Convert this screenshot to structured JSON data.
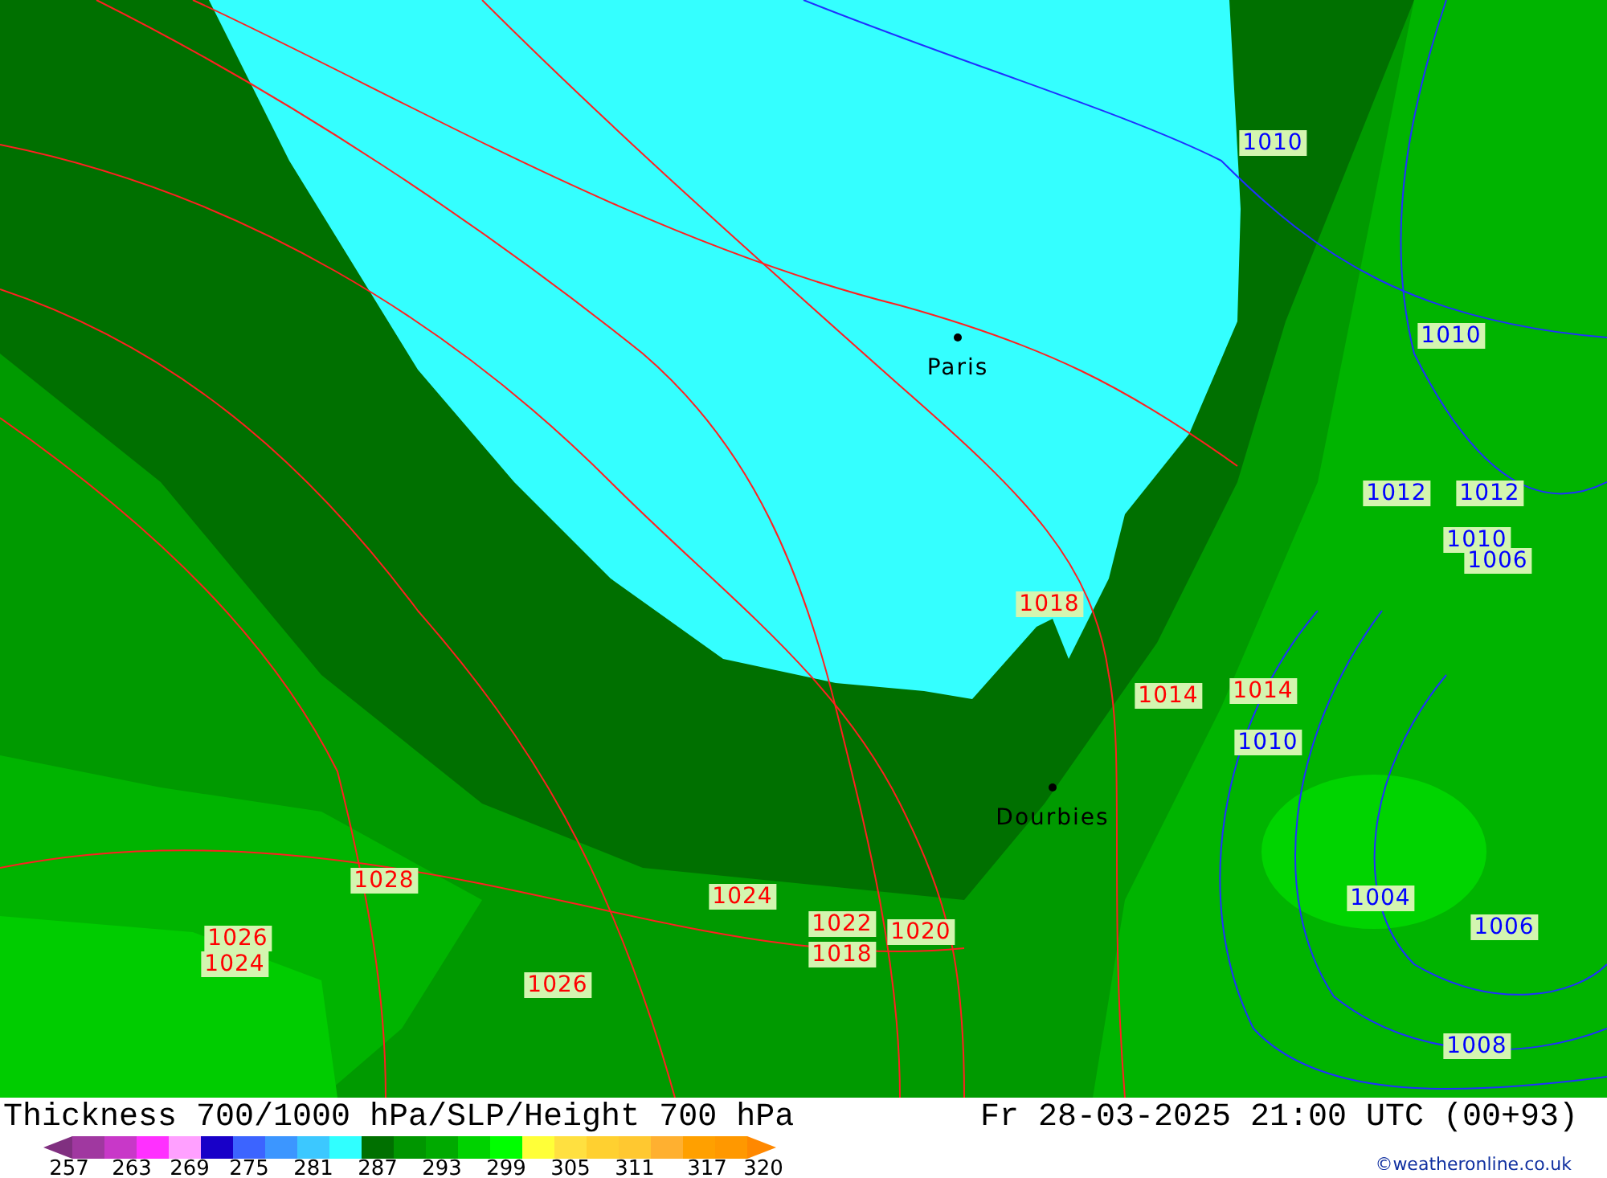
{
  "map": {
    "cities": [
      {
        "name": "Paris"
      },
      {
        "name": "Dourbies"
      }
    ],
    "contour_labels": [
      {
        "text": "1010",
        "color": "#0000ff"
      },
      {
        "text": "1010",
        "color": "#0000ff"
      },
      {
        "text": "1012",
        "color": "#0000ff"
      },
      {
        "text": "1012",
        "color": "#0000ff"
      },
      {
        "text": "1010",
        "color": "#0000ff"
      },
      {
        "text": "1006",
        "color": "#0000ff"
      },
      {
        "text": "1018",
        "color": "#ff0000"
      },
      {
        "text": "1014",
        "color": "#ff0000"
      },
      {
        "text": "1014",
        "color": "#ff0000"
      },
      {
        "text": "1010",
        "color": "#0000ff"
      },
      {
        "text": "1028",
        "color": "#ff0000"
      },
      {
        "text": "1024",
        "color": "#ff0000"
      },
      {
        "text": "1022",
        "color": "#ff0000"
      },
      {
        "text": "1020",
        "color": "#ff0000"
      },
      {
        "text": "1018",
        "color": "#ff0000"
      },
      {
        "text": "1026",
        "color": "#ff0000"
      },
      {
        "text": "1024",
        "color": "#ff0000"
      },
      {
        "text": "1004",
        "color": "#0000ff"
      },
      {
        "text": "1006",
        "color": "#0000ff"
      },
      {
        "text": "1026",
        "color": "#ff0000"
      },
      {
        "text": "1008",
        "color": "#0000ff"
      }
    ]
  },
  "title": "Thickness 700/1000 hPa/SLP/Height 700 hPa",
  "valid_time": "Fr 28-03-2025 21:00 UTC (00+93)",
  "legend": {
    "colors": [
      {
        "kind": "arrow",
        "color": "#803080"
      },
      {
        "kind": "swatch",
        "color": "#a038a0"
      },
      {
        "kind": "swatch",
        "color": "#c838c8"
      },
      {
        "kind": "swatch",
        "color": "#ff30ff"
      },
      {
        "kind": "swatch",
        "color": "#ffa0ff"
      },
      {
        "kind": "swatch",
        "color": "#1800c8"
      },
      {
        "kind": "swatch",
        "color": "#3c64ff"
      },
      {
        "kind": "swatch",
        "color": "#3c96ff"
      },
      {
        "kind": "swatch",
        "color": "#3cc8ff"
      },
      {
        "kind": "swatch",
        "color": "#30ffff"
      },
      {
        "kind": "swatch",
        "color": "#007000"
      },
      {
        "kind": "swatch",
        "color": "#009600"
      },
      {
        "kind": "swatch",
        "color": "#00aa00"
      },
      {
        "kind": "swatch",
        "color": "#00d200"
      },
      {
        "kind": "swatch",
        "color": "#00ff00"
      },
      {
        "kind": "swatch",
        "color": "#ffff38"
      },
      {
        "kind": "swatch",
        "color": "#ffe040"
      },
      {
        "kind": "swatch",
        "color": "#ffd030"
      },
      {
        "kind": "swatch",
        "color": "#ffc830"
      },
      {
        "kind": "swatch",
        "color": "#ffb030"
      },
      {
        "kind": "swatch",
        "color": "#ffa000"
      },
      {
        "kind": "swatch",
        "color": "#ff9800"
      },
      {
        "kind": "arrow",
        "color": "#ff8800"
      }
    ],
    "labels": [
      "257",
      "263",
      "269",
      "275",
      "281",
      "287",
      "293",
      "299",
      "305",
      "311",
      "317",
      "320"
    ]
  },
  "credit": "©weatheronline.co.uk"
}
